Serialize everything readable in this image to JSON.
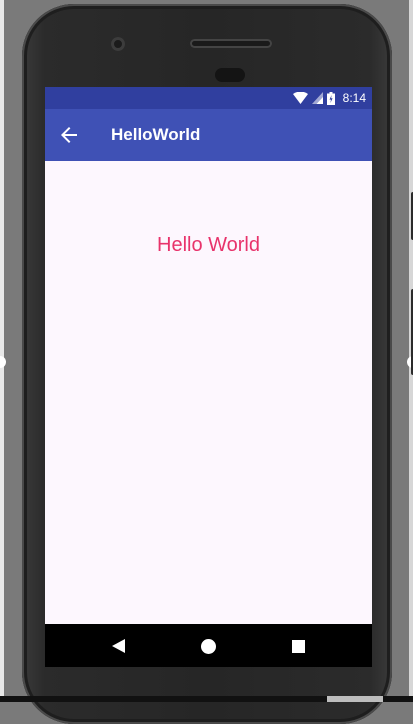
{
  "status_bar": {
    "time": "8:14",
    "icons": [
      "wifi-icon",
      "signal-icon",
      "battery-icon"
    ]
  },
  "app_bar": {
    "title": "HelloWorld",
    "back_icon": "arrow-left-icon"
  },
  "content": {
    "message": "Hello World"
  },
  "nav_bar": {
    "buttons": [
      "back-triangle-icon",
      "home-circle-icon",
      "recents-square-icon"
    ]
  },
  "colors": {
    "status_bar": "#303f9f",
    "app_bar": "#3f51b5",
    "content_bg": "#fdf7fe",
    "accent_text": "#e8336b",
    "nav_bar": "#000000"
  }
}
